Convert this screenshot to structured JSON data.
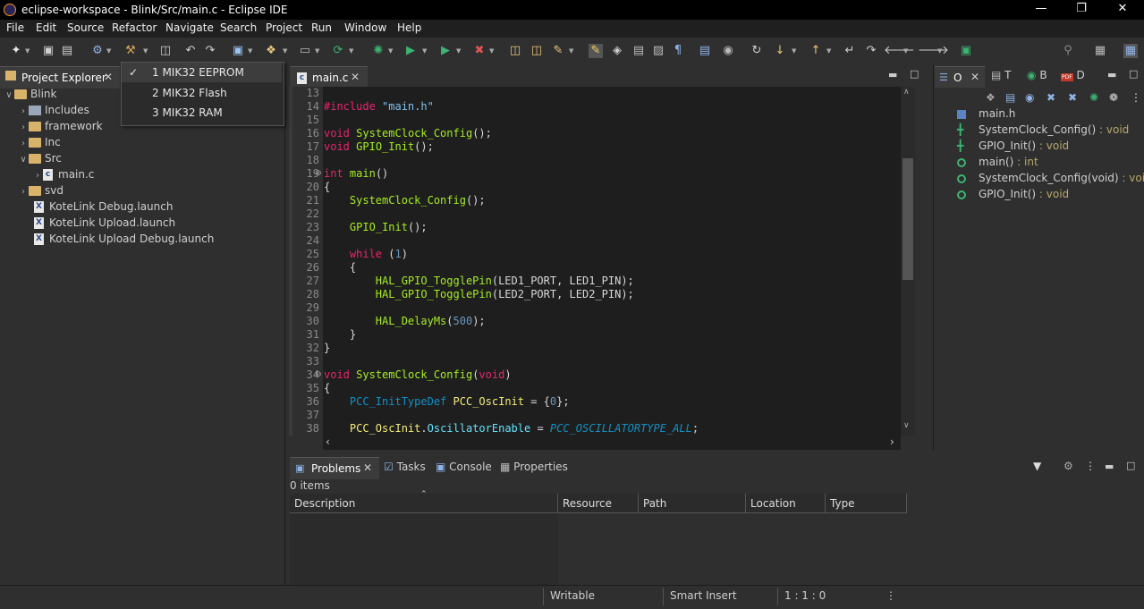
{
  "window": {
    "title": "eclipse-workspace - Blink/Src/main.c - Eclipse IDE"
  },
  "menubar": {
    "items": [
      "File",
      "Edit",
      "Source",
      "Refactor",
      "Navigate",
      "Search",
      "Project",
      "Run",
      "Window",
      "Help"
    ]
  },
  "dropdown": {
    "items": [
      {
        "label": "1 MIK32 EEPROM",
        "checked": true
      },
      {
        "label": "2 MIK32 Flash",
        "checked": false
      },
      {
        "label": "3 MIK32 RAM",
        "checked": false
      }
    ]
  },
  "project_explorer": {
    "tab_label": "Project Explorer",
    "tree": [
      {
        "label": "Blink",
        "expanded": true
      },
      {
        "label": "Includes"
      },
      {
        "label": "framework"
      },
      {
        "label": "Inc"
      },
      {
        "label": "Src",
        "expanded": true
      },
      {
        "label": "main.c"
      },
      {
        "label": "svd"
      },
      {
        "label": "KoteLink Debug.launch"
      },
      {
        "label": "KoteLink Upload.launch"
      },
      {
        "label": "KoteLink Upload Debug.launch"
      }
    ]
  },
  "editor": {
    "tab_label": "main.c",
    "line_numbers": [
      "13",
      "14",
      "15",
      "16",
      "17",
      "18",
      "19",
      "20",
      "21",
      "22",
      "23",
      "24",
      "25",
      "26",
      "27",
      "28",
      "29",
      "30",
      "31",
      "32",
      "33",
      "34",
      "35",
      "36",
      "37",
      "38"
    ],
    "code": {
      "l14_pre": "#include",
      "l14_str": "\"main.h\"",
      "l16_kw": "void",
      "l16_fn": "SystemClock_Config",
      "l16_rest": "();",
      "l17_kw": "void",
      "l17_fn": "GPIO_Init",
      "l17_rest": "();",
      "l19_kw": "int",
      "l19_fn": "main",
      "l19_rest": "()",
      "l20": "{",
      "l21_fn": "SystemClock_Config",
      "l21_rest": "();",
      "l23_fn": "GPIO_Init",
      "l23_rest": "();",
      "l25_kw": "while",
      "l25_open": " (",
      "l25_num": "1",
      "l25_close": ")",
      "l26": "{",
      "l27_fn": "HAL_GPIO_TogglePin",
      "l27_rest": "(LED1_PORT, LED1_PIN);",
      "l28_fn": "HAL_GPIO_TogglePin",
      "l28_rest": "(LED2_PORT, LED2_PIN);",
      "l30_fn": "HAL_DelayMs",
      "l30_open": "(",
      "l30_num": "500",
      "l30_close": ");",
      "l31": "}",
      "l32": "}",
      "l34_kw": "void",
      "l34_fn": "SystemClock_Config",
      "l34_open": "(",
      "l34_kw2": "void",
      "l34_close": ")",
      "l35": "{",
      "l36_ty": "PCC_InitTypeDef",
      "l36_var": "PCC_OscInit",
      "l36_eq": " = {",
      "l36_num": "0",
      "l36_close": "};",
      "l38_var": "PCC_OscInit",
      "l38_dot": ".",
      "l38_mem": "OscillatorEnable",
      "l38_eq": " = ",
      "l38_it": "PCC_OSCILLATORTYPE_ALL",
      "l38_end": ";"
    }
  },
  "right_tabs": {
    "o": "O",
    "t": "T",
    "b": "B",
    "d": "D",
    "pdf": "PDF"
  },
  "outline": {
    "items": [
      {
        "name": "main.h",
        "type": ""
      },
      {
        "name": "SystemClock_Config()",
        "type": " : void"
      },
      {
        "name": "GPIO_Init()",
        "type": " : void"
      },
      {
        "name": "main()",
        "type": " : int"
      },
      {
        "name": "SystemClock_Config(void)",
        "type": " : void"
      },
      {
        "name": "GPIO_Init()",
        "type": " : void"
      }
    ]
  },
  "bottom": {
    "tabs": [
      "Problems",
      "Tasks",
      "Console",
      "Properties"
    ],
    "count_text": "0 items",
    "columns": [
      "Description",
      "Resource",
      "Path",
      "Location",
      "Type"
    ]
  },
  "statusbar": {
    "writable": "Writable",
    "insert_mode": "Smart Insert",
    "position": "1 : 1 : 0"
  },
  "colors": {
    "keyword": "#e5266d",
    "function": "#a7ec21",
    "type": "#1290c3",
    "editor_bg": "#1e1e1e",
    "ui_bg": "#2f2f2f"
  }
}
